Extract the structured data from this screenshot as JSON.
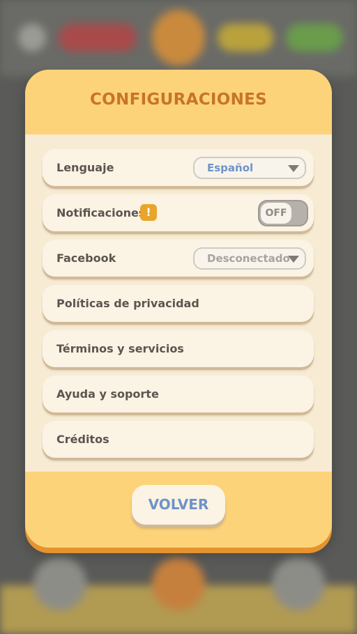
{
  "dialog": {
    "title": "CONFIGURACIONES",
    "back_label": "VOLVER"
  },
  "settings": {
    "language": {
      "label": "Lenguaje",
      "value": "Español"
    },
    "notifications": {
      "label": "Notificaciones",
      "warning": "!",
      "toggle": "OFF"
    },
    "facebook": {
      "label": "Facebook",
      "value": "Desconectado"
    },
    "privacy": {
      "label": "Políticas de privacidad"
    },
    "terms": {
      "label": "Términos y servicios"
    },
    "help": {
      "label": "Ayuda y soporte"
    },
    "credits": {
      "label": "Créditos"
    }
  },
  "colors": {
    "title": "#c8742a",
    "accent_blue": "#6e93c8",
    "disabled_text": "#a8a39d",
    "warning": "#e9a42c",
    "modal": "#fdd37a",
    "modal_shadow": "#e4932e"
  }
}
